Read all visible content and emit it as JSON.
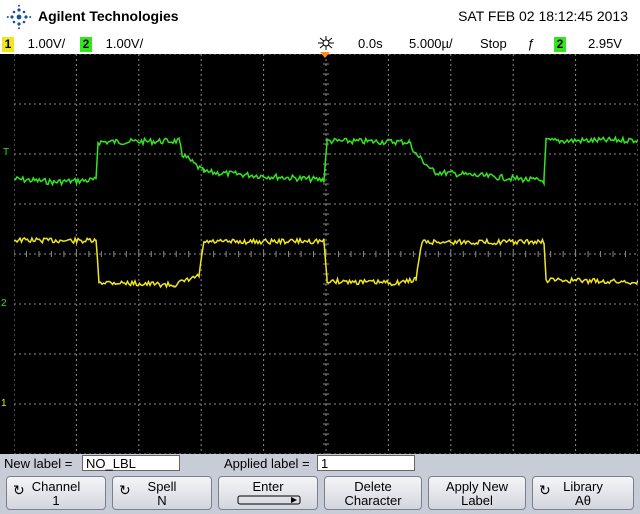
{
  "header": {
    "brand": "Agilent Technologies",
    "datetime": "SAT FEB 02 18:12:45 2013"
  },
  "status": {
    "ch1_num": "1",
    "ch1_scale": "1.00V/",
    "ch2_num": "2",
    "ch2_scale": "1.00V/",
    "time_delay": "0.0s",
    "time_scale": "5.000µ/",
    "run_state": "Stop",
    "trigger_edge": "ƒ",
    "trigger_ch": "2",
    "trigger_level": "2.95V"
  },
  "markers": {
    "ch1": "1",
    "ch2": "2",
    "trigger": "T"
  },
  "colors": {
    "ch1": "#f0e61e",
    "ch2": "#32e61e",
    "grid": "#8a8a8a",
    "trigger": "#ff8c1a"
  },
  "label_bar": {
    "new_label_text": "New label =",
    "new_label_value": "NO_LBL",
    "applied_label_text": "Applied label =",
    "applied_label_value": "1"
  },
  "softkeys": [
    {
      "icon": "knob-icon",
      "line1": "Channel",
      "line2": "1"
    },
    {
      "icon": "knob-icon",
      "line1": "Spell",
      "line2": "N"
    },
    {
      "icon": "enter-arrow-icon",
      "line1": "Enter",
      "line2": ""
    },
    {
      "icon": "",
      "line1": "Delete",
      "line2": "Character"
    },
    {
      "icon": "",
      "line1": "Apply New",
      "line2": "Label"
    },
    {
      "icon": "knob-icon",
      "line1": "Library",
      "line2": "Aθ"
    }
  ]
}
